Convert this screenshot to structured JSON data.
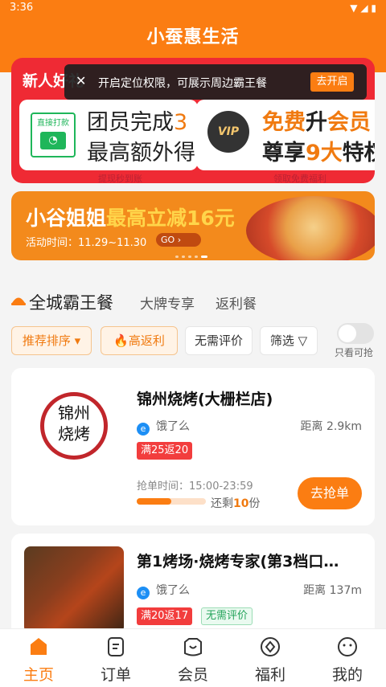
{
  "status_bar": {
    "time": "3:36"
  },
  "app": {
    "title": "小蚕惠生活"
  },
  "toast": {
    "message": "开启定位权限，可展示周边霸王餐",
    "button": "去开启"
  },
  "promo": {
    "label": "新人好礼",
    "card1": {
      "logo_text": "直接打款",
      "line1": "团员完成",
      "line1_hi": "3",
      "line2": "最高额外得",
      "sub": "提现秒到账"
    },
    "card2": {
      "logo_text": "VIP",
      "line1_hi": "免费",
      "line1_mid": "升",
      "line1_hi2": "会员",
      "line2_a": "尊享",
      "line2_hi": "9大",
      "line2_b": "特权",
      "sub": "领取免费福利"
    }
  },
  "banner": {
    "title": "小谷姐姐",
    "highlight": "最高立减16元",
    "time_text": "活动时间：11.29~11.30",
    "go": "GO"
  },
  "section": {
    "tabs": [
      "全城霸王餐",
      "大牌专享",
      "返利餐"
    ]
  },
  "filters": {
    "sort": "推荐排序",
    "high_rebate": "高返利",
    "no_review": "无需评价",
    "filter": "筛选",
    "toggle_label": "只看可抢"
  },
  "stores": [
    {
      "name": "锦州烧烤(大栅栏店)",
      "logo_text": "锦州烧烤",
      "platform": "饿了么",
      "distance": "距离 2.9km",
      "tags": [
        "满25返20"
      ],
      "grab_time": "抢单时间：15:00-23:59",
      "remaining_prefix": "还剩",
      "remaining_count": "10",
      "remaining_suffix": "份",
      "progress": 0.5,
      "button": "去抢单"
    },
    {
      "name": "第1烤场·烧烤专家(第3档口…",
      "platform": "饿了么",
      "distance": "距离 137m",
      "tags": [
        "满20返17",
        "无需评价"
      ]
    }
  ],
  "nav": [
    {
      "label": "主页",
      "icon": "home-icon",
      "active": true
    },
    {
      "label": "订单",
      "icon": "order-icon",
      "active": false
    },
    {
      "label": "会员",
      "icon": "member-icon",
      "active": false
    },
    {
      "label": "福利",
      "icon": "welfare-icon",
      "active": false
    },
    {
      "label": "我的",
      "icon": "profile-icon",
      "active": false
    }
  ],
  "colors": {
    "brand": "#fb7d12",
    "promo_red": "#ef2a34",
    "tag_red": "#f23d3d"
  }
}
